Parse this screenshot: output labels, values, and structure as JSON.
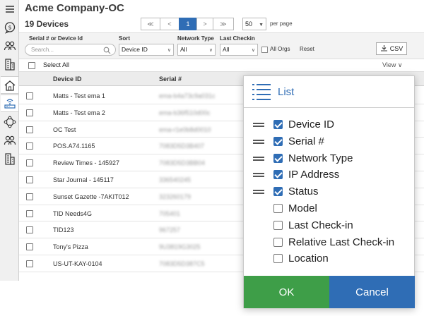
{
  "app": {
    "title": "Acme Company-OC",
    "device_count": "19 Devices"
  },
  "sidebar": {
    "items": [
      {
        "name": "menu-icon"
      },
      {
        "name": "support-chat-icon"
      },
      {
        "name": "users-icon"
      },
      {
        "name": "buildings-icon"
      },
      {
        "name": "home-icon"
      },
      {
        "name": "router-icon"
      },
      {
        "name": "network-icon"
      },
      {
        "name": "people-icon"
      },
      {
        "name": "building-icon"
      }
    ]
  },
  "pagination": {
    "first": "≪",
    "prev": "<",
    "current": "1",
    "next": ">",
    "last": "≫",
    "per_page_value": "50",
    "per_page_label": "per page"
  },
  "filters": {
    "search_label": "Serial # or Device Id",
    "search_placeholder": "Search...",
    "sort_label": "Sort",
    "sort_value": "Device ID",
    "network_type_label": "Network Type",
    "network_type_value": "All",
    "last_checkin_label": "Last Checkin",
    "last_checkin_value": "All",
    "all_orgs_label": "All Orgs",
    "reset_label": "Reset",
    "csv_label": "CSV"
  },
  "table": {
    "select_all_label": "Select All",
    "view_label": "View",
    "columns": [
      "Device ID",
      "Serial #"
    ],
    "rows": [
      {
        "device_id": "Matts - Test ema 1",
        "serial": "ema-b4a73c9a031c"
      },
      {
        "device_id": "Matts - Test ema 2",
        "serial": "ema-b36f510d00c"
      },
      {
        "device_id": "OC Test",
        "serial": "ema-r1e0b8d0010"
      },
      {
        "device_id": "POS.A74.1165",
        "serial": "7083D5D3B407"
      },
      {
        "device_id": "Review Times - 145927",
        "serial": "7083D5D3BB04"
      },
      {
        "device_id": "Star Journal - 145117",
        "serial": "336540245"
      },
      {
        "device_id": "Sunset Gazette -7AKIT012",
        "serial": "323260179"
      },
      {
        "device_id": "TID Needs4G",
        "serial": "705401"
      },
      {
        "device_id": "TID123",
        "serial": "967257"
      },
      {
        "device_id": "Tony's Pizza",
        "serial": "9U3819G3025"
      },
      {
        "device_id": "US-UT-KAY-0104",
        "serial": "7083D5D387C5"
      }
    ]
  },
  "column_chooser": {
    "title": "List",
    "options": [
      {
        "label": "Device ID",
        "checked": true,
        "draggable": true
      },
      {
        "label": "Serial #",
        "checked": true,
        "draggable": true
      },
      {
        "label": "Network Type",
        "checked": true,
        "draggable": true
      },
      {
        "label": "IP Address",
        "checked": true,
        "draggable": true
      },
      {
        "label": "Status",
        "checked": true,
        "draggable": true
      },
      {
        "label": "Model",
        "checked": false,
        "draggable": false
      },
      {
        "label": "Last Check-in",
        "checked": false,
        "draggable": false
      },
      {
        "label": "Relative Last Check-in",
        "checked": false,
        "draggable": false
      },
      {
        "label": "Location",
        "checked": false,
        "draggable": false
      }
    ],
    "ok_label": "OK",
    "cancel_label": "Cancel"
  },
  "colors": {
    "accent": "#2f6db5",
    "ok": "#3e9e48",
    "sidebar_bg": "#f0f0f0"
  }
}
